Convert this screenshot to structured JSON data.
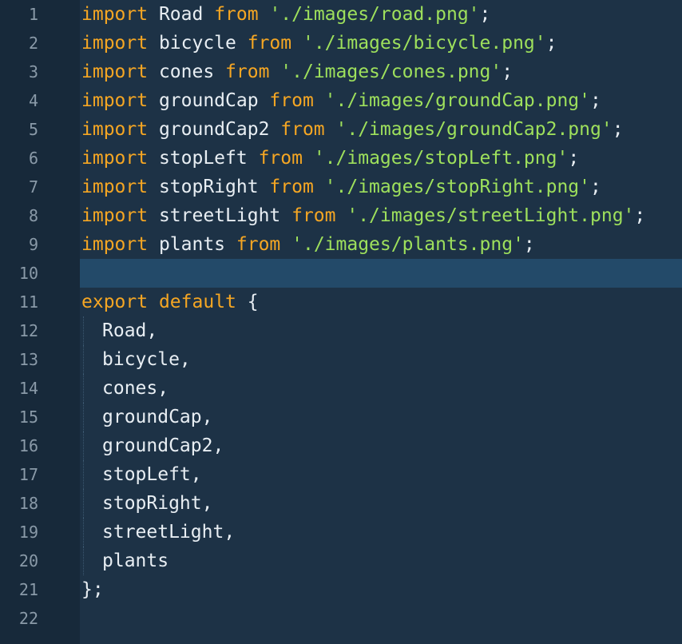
{
  "lines": [
    {
      "n": "1",
      "parts": [
        {
          "t": "import",
          "c": "kw"
        },
        {
          "t": " Road ",
          "c": "ident"
        },
        {
          "t": "from",
          "c": "kw"
        },
        {
          "t": " ",
          "c": "ident"
        },
        {
          "t": "'./images/road.png'",
          "c": "str"
        },
        {
          "t": ";",
          "c": "punc"
        }
      ]
    },
    {
      "n": "2",
      "parts": [
        {
          "t": "import",
          "c": "kw"
        },
        {
          "t": " bicycle ",
          "c": "ident"
        },
        {
          "t": "from",
          "c": "kw"
        },
        {
          "t": " ",
          "c": "ident"
        },
        {
          "t": "'./images/bicycle.png'",
          "c": "str"
        },
        {
          "t": ";",
          "c": "punc"
        }
      ]
    },
    {
      "n": "3",
      "parts": [
        {
          "t": "import",
          "c": "kw"
        },
        {
          "t": " cones ",
          "c": "ident"
        },
        {
          "t": "from",
          "c": "kw"
        },
        {
          "t": " ",
          "c": "ident"
        },
        {
          "t": "'./images/cones.png'",
          "c": "str"
        },
        {
          "t": ";",
          "c": "punc"
        }
      ]
    },
    {
      "n": "4",
      "parts": [
        {
          "t": "import",
          "c": "kw"
        },
        {
          "t": " groundCap ",
          "c": "ident"
        },
        {
          "t": "from",
          "c": "kw"
        },
        {
          "t": " ",
          "c": "ident"
        },
        {
          "t": "'./images/groundCap.png'",
          "c": "str"
        },
        {
          "t": ";",
          "c": "punc"
        }
      ]
    },
    {
      "n": "5",
      "parts": [
        {
          "t": "import",
          "c": "kw"
        },
        {
          "t": " groundCap2 ",
          "c": "ident"
        },
        {
          "t": "from",
          "c": "kw"
        },
        {
          "t": " ",
          "c": "ident"
        },
        {
          "t": "'./images/groundCap2.png'",
          "c": "str"
        },
        {
          "t": ";",
          "c": "punc"
        }
      ]
    },
    {
      "n": "6",
      "parts": [
        {
          "t": "import",
          "c": "kw"
        },
        {
          "t": " stopLeft ",
          "c": "ident"
        },
        {
          "t": "from",
          "c": "kw"
        },
        {
          "t": " ",
          "c": "ident"
        },
        {
          "t": "'./images/stopLeft.png'",
          "c": "str"
        },
        {
          "t": ";",
          "c": "punc"
        }
      ]
    },
    {
      "n": "7",
      "parts": [
        {
          "t": "import",
          "c": "kw"
        },
        {
          "t": " stopRight ",
          "c": "ident"
        },
        {
          "t": "from",
          "c": "kw"
        },
        {
          "t": " ",
          "c": "ident"
        },
        {
          "t": "'./images/stopRight.png'",
          "c": "str"
        },
        {
          "t": ";",
          "c": "punc"
        }
      ]
    },
    {
      "n": "8",
      "parts": [
        {
          "t": "import",
          "c": "kw"
        },
        {
          "t": " streetLight ",
          "c": "ident"
        },
        {
          "t": "from",
          "c": "kw"
        },
        {
          "t": " ",
          "c": "ident"
        },
        {
          "t": "'./images/streetLight.png'",
          "c": "str"
        },
        {
          "t": ";",
          "c": "punc"
        }
      ]
    },
    {
      "n": "9",
      "parts": [
        {
          "t": "import",
          "c": "kw"
        },
        {
          "t": " plants ",
          "c": "ident"
        },
        {
          "t": "from",
          "c": "kw"
        },
        {
          "t": " ",
          "c": "ident"
        },
        {
          "t": "'./images/plants.png'",
          "c": "str"
        },
        {
          "t": ";",
          "c": "punc"
        }
      ]
    },
    {
      "n": "10",
      "active": true,
      "parts": []
    },
    {
      "n": "11",
      "parts": [
        {
          "t": "export",
          "c": "kw"
        },
        {
          "t": " ",
          "c": "ident"
        },
        {
          "t": "default",
          "c": "kw"
        },
        {
          "t": " {",
          "c": "punc"
        }
      ]
    },
    {
      "n": "12",
      "indent": 1,
      "parts": [
        {
          "t": "Road,",
          "c": "ident"
        }
      ]
    },
    {
      "n": "13",
      "indent": 1,
      "parts": [
        {
          "t": "bicycle,",
          "c": "ident"
        }
      ]
    },
    {
      "n": "14",
      "indent": 1,
      "parts": [
        {
          "t": "cones,",
          "c": "ident"
        }
      ]
    },
    {
      "n": "15",
      "indent": 1,
      "parts": [
        {
          "t": "groundCap,",
          "c": "ident"
        }
      ]
    },
    {
      "n": "16",
      "indent": 1,
      "parts": [
        {
          "t": "groundCap2,",
          "c": "ident"
        }
      ]
    },
    {
      "n": "17",
      "indent": 1,
      "parts": [
        {
          "t": "stopLeft,",
          "c": "ident"
        }
      ]
    },
    {
      "n": "18",
      "indent": 1,
      "parts": [
        {
          "t": "stopRight,",
          "c": "ident"
        }
      ]
    },
    {
      "n": "19",
      "indent": 1,
      "parts": [
        {
          "t": "streetLight,",
          "c": "ident"
        }
      ]
    },
    {
      "n": "20",
      "indent": 1,
      "parts": [
        {
          "t": "plants",
          "c": "ident"
        }
      ]
    },
    {
      "n": "21",
      "parts": [
        {
          "t": "};",
          "c": "punc"
        }
      ]
    },
    {
      "n": "22",
      "parts": []
    }
  ],
  "colors": {
    "keyword": "#f5a623",
    "string": "#9ee05c",
    "text": "#e8eef3",
    "line_number": "#8a9aa8",
    "background": "#1d3246",
    "active_line": "#234a69"
  }
}
